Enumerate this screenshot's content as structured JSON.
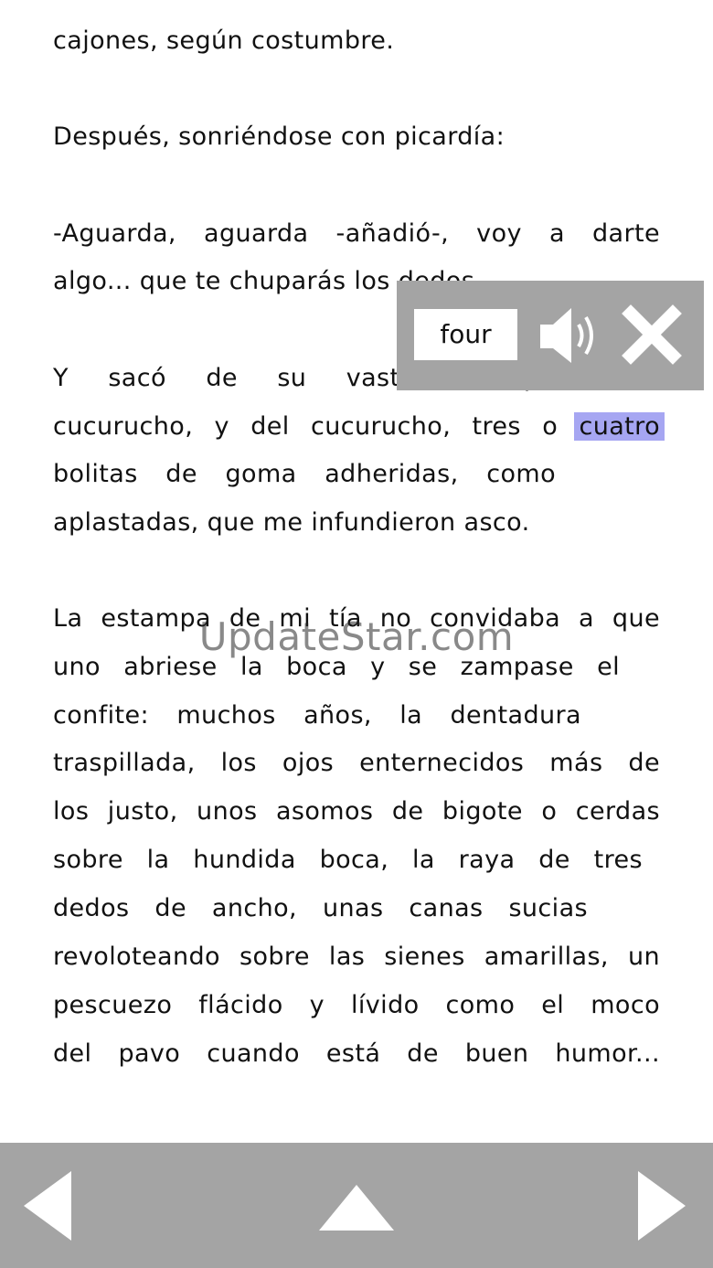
{
  "book": {
    "lines": [
      {
        "text": "cajones, según costumbre."
      },
      {
        "text": "Después, sonriéndose con picardía:"
      },
      {
        "text": "-Aguarda, aguarda -añadió-, voy a darte"
      },
      {
        "text": "algo... que te chuparás los dedos."
      },
      {
        "text": "Y sacó de su vasta faltriquera un"
      },
      {
        "before": "cucurucho, y del cucurucho, tres o ",
        "highlight": "cuatro"
      },
      {
        "text": "bolitas de goma adheridas, como"
      },
      {
        "text": "aplastadas, que me infundieron asco."
      },
      {
        "text": "La estampa de mi tía no convidaba a que"
      },
      {
        "text": "uno abriese la boca y se zampase el"
      },
      {
        "text": "confite: muchos años, la dentadura"
      },
      {
        "text": "traspillada, los ojos enternecidos más de"
      },
      {
        "text": "los justo, unos asomos de bigote o cerdas"
      },
      {
        "text": "sobre la hundida boca, la raya de tres"
      },
      {
        "text": "dedos de ancho, unas canas sucias"
      },
      {
        "text": "revoloteando sobre las sienes amarillas, un"
      },
      {
        "text": "pescuezo flácido y lívido como el moco"
      },
      {
        "text": "del pavo cuando está de buen humor..."
      }
    ]
  },
  "popup": {
    "translation": "four",
    "speaker_icon": "speaker-icon",
    "close_icon": "close-icon"
  },
  "watermark": "UpdateStar.com",
  "nav": {
    "prev_icon": "left-triangle-icon",
    "up_icon": "up-triangle-icon",
    "next_icon": "right-triangle-icon"
  },
  "colors": {
    "highlight": "#a6a6f2",
    "panel": "#a4a4a4",
    "text": "#111111"
  }
}
